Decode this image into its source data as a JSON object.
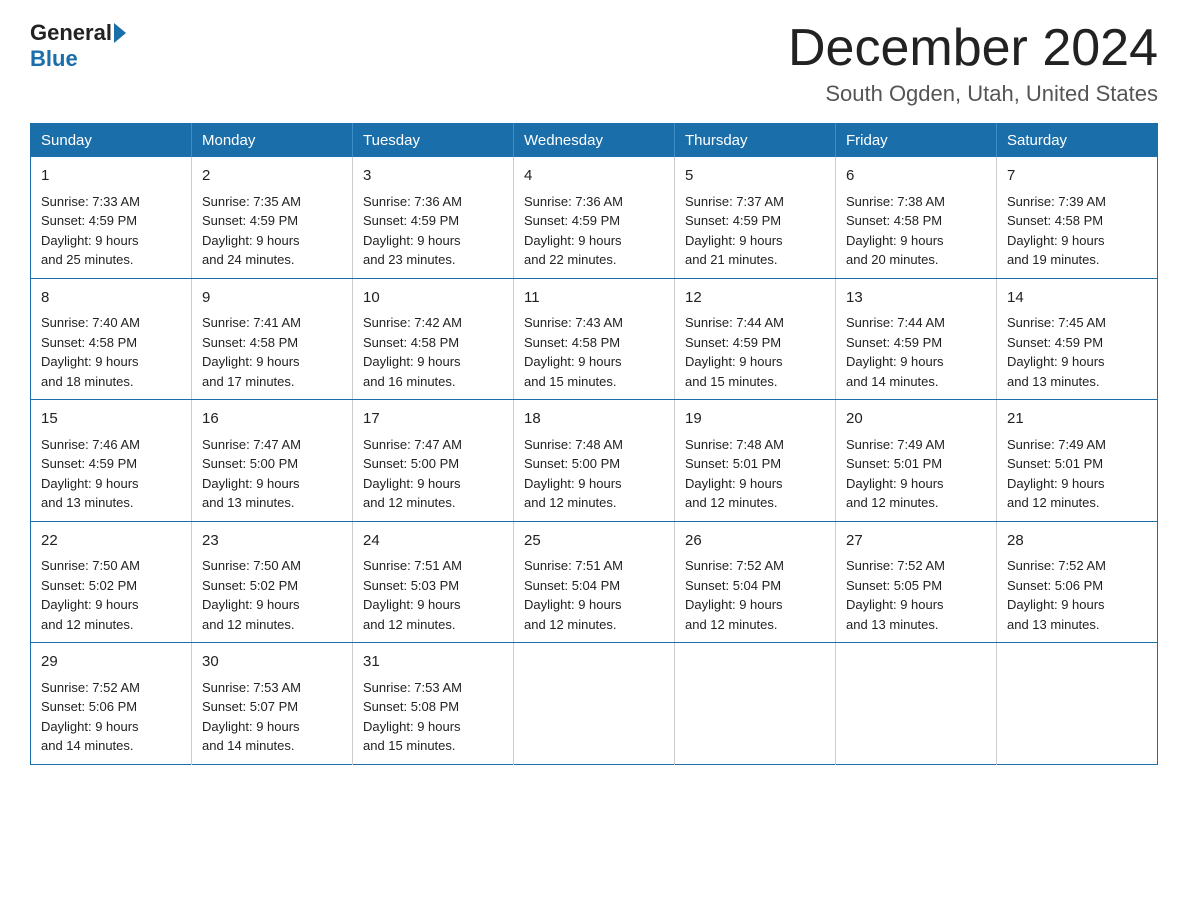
{
  "logo": {
    "general": "General",
    "blue": "Blue"
  },
  "header": {
    "month": "December 2024",
    "location": "South Ogden, Utah, United States"
  },
  "weekdays": [
    "Sunday",
    "Monday",
    "Tuesday",
    "Wednesday",
    "Thursday",
    "Friday",
    "Saturday"
  ],
  "weeks": [
    [
      {
        "day": "1",
        "sunrise": "7:33 AM",
        "sunset": "4:59 PM",
        "daylight": "9 hours and 25 minutes."
      },
      {
        "day": "2",
        "sunrise": "7:35 AM",
        "sunset": "4:59 PM",
        "daylight": "9 hours and 24 minutes."
      },
      {
        "day": "3",
        "sunrise": "7:36 AM",
        "sunset": "4:59 PM",
        "daylight": "9 hours and 23 minutes."
      },
      {
        "day": "4",
        "sunrise": "7:36 AM",
        "sunset": "4:59 PM",
        "daylight": "9 hours and 22 minutes."
      },
      {
        "day": "5",
        "sunrise": "7:37 AM",
        "sunset": "4:59 PM",
        "daylight": "9 hours and 21 minutes."
      },
      {
        "day": "6",
        "sunrise": "7:38 AM",
        "sunset": "4:58 PM",
        "daylight": "9 hours and 20 minutes."
      },
      {
        "day": "7",
        "sunrise": "7:39 AM",
        "sunset": "4:58 PM",
        "daylight": "9 hours and 19 minutes."
      }
    ],
    [
      {
        "day": "8",
        "sunrise": "7:40 AM",
        "sunset": "4:58 PM",
        "daylight": "9 hours and 18 minutes."
      },
      {
        "day": "9",
        "sunrise": "7:41 AM",
        "sunset": "4:58 PM",
        "daylight": "9 hours and 17 minutes."
      },
      {
        "day": "10",
        "sunrise": "7:42 AM",
        "sunset": "4:58 PM",
        "daylight": "9 hours and 16 minutes."
      },
      {
        "day": "11",
        "sunrise": "7:43 AM",
        "sunset": "4:58 PM",
        "daylight": "9 hours and 15 minutes."
      },
      {
        "day": "12",
        "sunrise": "7:44 AM",
        "sunset": "4:59 PM",
        "daylight": "9 hours and 15 minutes."
      },
      {
        "day": "13",
        "sunrise": "7:44 AM",
        "sunset": "4:59 PM",
        "daylight": "9 hours and 14 minutes."
      },
      {
        "day": "14",
        "sunrise": "7:45 AM",
        "sunset": "4:59 PM",
        "daylight": "9 hours and 13 minutes."
      }
    ],
    [
      {
        "day": "15",
        "sunrise": "7:46 AM",
        "sunset": "4:59 PM",
        "daylight": "9 hours and 13 minutes."
      },
      {
        "day": "16",
        "sunrise": "7:47 AM",
        "sunset": "5:00 PM",
        "daylight": "9 hours and 13 minutes."
      },
      {
        "day": "17",
        "sunrise": "7:47 AM",
        "sunset": "5:00 PM",
        "daylight": "9 hours and 12 minutes."
      },
      {
        "day": "18",
        "sunrise": "7:48 AM",
        "sunset": "5:00 PM",
        "daylight": "9 hours and 12 minutes."
      },
      {
        "day": "19",
        "sunrise": "7:48 AM",
        "sunset": "5:01 PM",
        "daylight": "9 hours and 12 minutes."
      },
      {
        "day": "20",
        "sunrise": "7:49 AM",
        "sunset": "5:01 PM",
        "daylight": "9 hours and 12 minutes."
      },
      {
        "day": "21",
        "sunrise": "7:49 AM",
        "sunset": "5:01 PM",
        "daylight": "9 hours and 12 minutes."
      }
    ],
    [
      {
        "day": "22",
        "sunrise": "7:50 AM",
        "sunset": "5:02 PM",
        "daylight": "9 hours and 12 minutes."
      },
      {
        "day": "23",
        "sunrise": "7:50 AM",
        "sunset": "5:02 PM",
        "daylight": "9 hours and 12 minutes."
      },
      {
        "day": "24",
        "sunrise": "7:51 AM",
        "sunset": "5:03 PM",
        "daylight": "9 hours and 12 minutes."
      },
      {
        "day": "25",
        "sunrise": "7:51 AM",
        "sunset": "5:04 PM",
        "daylight": "9 hours and 12 minutes."
      },
      {
        "day": "26",
        "sunrise": "7:52 AM",
        "sunset": "5:04 PM",
        "daylight": "9 hours and 12 minutes."
      },
      {
        "day": "27",
        "sunrise": "7:52 AM",
        "sunset": "5:05 PM",
        "daylight": "9 hours and 13 minutes."
      },
      {
        "day": "28",
        "sunrise": "7:52 AM",
        "sunset": "5:06 PM",
        "daylight": "9 hours and 13 minutes."
      }
    ],
    [
      {
        "day": "29",
        "sunrise": "7:52 AM",
        "sunset": "5:06 PM",
        "daylight": "9 hours and 14 minutes."
      },
      {
        "day": "30",
        "sunrise": "7:53 AM",
        "sunset": "5:07 PM",
        "daylight": "9 hours and 14 minutes."
      },
      {
        "day": "31",
        "sunrise": "7:53 AM",
        "sunset": "5:08 PM",
        "daylight": "9 hours and 15 minutes."
      },
      null,
      null,
      null,
      null
    ]
  ],
  "labels": {
    "sunrise": "Sunrise:",
    "sunset": "Sunset:",
    "daylight": "Daylight:"
  }
}
